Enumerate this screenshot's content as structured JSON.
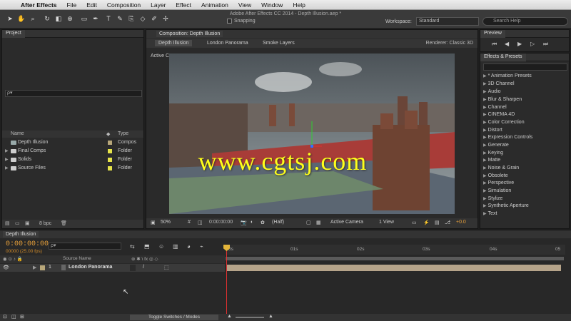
{
  "menubar": {
    "app": "After Effects",
    "items": [
      "File",
      "Edit",
      "Composition",
      "Layer",
      "Effect",
      "Animation",
      "View",
      "Window",
      "Help"
    ]
  },
  "toolbar": {
    "doc_title": "Adobe After Effects CC 2014 - Depth Illusion.aep *",
    "snapping": "Snapping",
    "workspace_label": "Workspace:",
    "workspace_value": "Standard",
    "search_placeholder": "Search Help"
  },
  "project": {
    "tab": "Project",
    "search": "ρ▾",
    "columns": {
      "name": "Name",
      "type": "Type"
    },
    "rows": [
      {
        "name": "Depth Illusion",
        "type": "Compos",
        "color": "#b8a77a"
      },
      {
        "name": "Final Comps",
        "type": "Folder",
        "color": "#e6e34a"
      },
      {
        "name": "Solids",
        "type": "Folder",
        "color": "#e6e34a"
      },
      {
        "name": "Source Files",
        "type": "Folder",
        "color": "#e6e34a"
      }
    ],
    "footer_bpc": "8 bpc"
  },
  "comp": {
    "tab": "Composition: Depth Illusion",
    "breadcrumbs": [
      "Depth Illusion",
      "London Panorama",
      "Smoke Layers"
    ],
    "renderer_label": "Renderer:",
    "renderer_value": "Classic 3D",
    "active_camera": "Active Camera",
    "footer": {
      "zoom": "50%",
      "timecode": "0:00:00:00",
      "resolution": "(Half)",
      "view": "Active Camera",
      "views": "1 View",
      "exposure": "+0.0"
    }
  },
  "preview": {
    "tab": "Preview"
  },
  "effects": {
    "tab": "Effects & Presets",
    "items": [
      "* Animation Presets",
      "3D Channel",
      "Audio",
      "Blur & Sharpen",
      "Channel",
      "CINEMA 4D",
      "Color Correction",
      "Distort",
      "Expression Controls",
      "Generate",
      "Keying",
      "Matte",
      "Noise & Grain",
      "Obsolete",
      "Perspective",
      "Simulation",
      "Stylize",
      "Synthetic Aperture",
      "Text"
    ]
  },
  "timeline": {
    "tab": "Depth Illusion",
    "timecode": "0:00:00:00",
    "fps": "00000 (25.00 fps)",
    "search": "ρ▾",
    "col_source": "Source Name",
    "layer": {
      "index": "1",
      "name": "London Panorama"
    },
    "ruler_ticks": [
      "0s",
      "01s",
      "02s",
      "03s",
      "04s",
      "05"
    ],
    "toggle": "Toggle Switches / Modes"
  },
  "watermark": "www.cgtsj.com",
  "colors": {
    "accent": "#e8a03a",
    "playhead": "#e03030",
    "layer_bar": "#b6a48a"
  }
}
